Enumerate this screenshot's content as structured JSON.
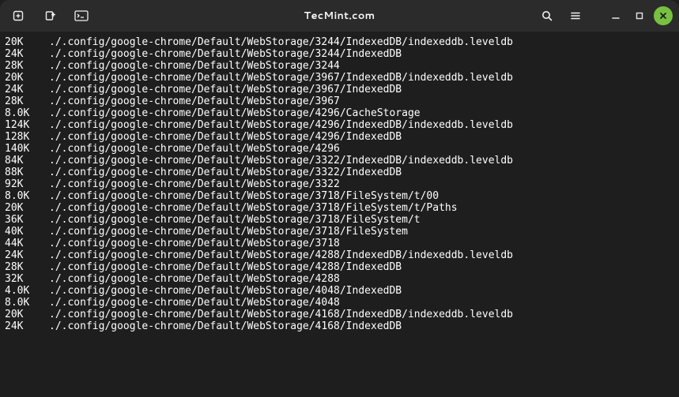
{
  "titlebar": {
    "title": "TecMint.com"
  },
  "lines": [
    {
      "size": "20K",
      "path": "./.config/google-chrome/Default/WebStorage/3244/IndexedDB/indexeddb.leveldb"
    },
    {
      "size": "24K",
      "path": "./.config/google-chrome/Default/WebStorage/3244/IndexedDB"
    },
    {
      "size": "28K",
      "path": "./.config/google-chrome/Default/WebStorage/3244"
    },
    {
      "size": "20K",
      "path": "./.config/google-chrome/Default/WebStorage/3967/IndexedDB/indexeddb.leveldb"
    },
    {
      "size": "24K",
      "path": "./.config/google-chrome/Default/WebStorage/3967/IndexedDB"
    },
    {
      "size": "28K",
      "path": "./.config/google-chrome/Default/WebStorage/3967"
    },
    {
      "size": "8.0K",
      "path": "./.config/google-chrome/Default/WebStorage/4296/CacheStorage"
    },
    {
      "size": "124K",
      "path": "./.config/google-chrome/Default/WebStorage/4296/IndexedDB/indexeddb.leveldb"
    },
    {
      "size": "128K",
      "path": "./.config/google-chrome/Default/WebStorage/4296/IndexedDB"
    },
    {
      "size": "140K",
      "path": "./.config/google-chrome/Default/WebStorage/4296"
    },
    {
      "size": "84K",
      "path": "./.config/google-chrome/Default/WebStorage/3322/IndexedDB/indexeddb.leveldb"
    },
    {
      "size": "88K",
      "path": "./.config/google-chrome/Default/WebStorage/3322/IndexedDB"
    },
    {
      "size": "92K",
      "path": "./.config/google-chrome/Default/WebStorage/3322"
    },
    {
      "size": "8.0K",
      "path": "./.config/google-chrome/Default/WebStorage/3718/FileSystem/t/00"
    },
    {
      "size": "20K",
      "path": "./.config/google-chrome/Default/WebStorage/3718/FileSystem/t/Paths"
    },
    {
      "size": "36K",
      "path": "./.config/google-chrome/Default/WebStorage/3718/FileSystem/t"
    },
    {
      "size": "40K",
      "path": "./.config/google-chrome/Default/WebStorage/3718/FileSystem"
    },
    {
      "size": "44K",
      "path": "./.config/google-chrome/Default/WebStorage/3718"
    },
    {
      "size": "24K",
      "path": "./.config/google-chrome/Default/WebStorage/4288/IndexedDB/indexeddb.leveldb"
    },
    {
      "size": "28K",
      "path": "./.config/google-chrome/Default/WebStorage/4288/IndexedDB"
    },
    {
      "size": "32K",
      "path": "./.config/google-chrome/Default/WebStorage/4288"
    },
    {
      "size": "4.0K",
      "path": "./.config/google-chrome/Default/WebStorage/4048/IndexedDB"
    },
    {
      "size": "8.0K",
      "path": "./.config/google-chrome/Default/WebStorage/4048"
    },
    {
      "size": "20K",
      "path": "./.config/google-chrome/Default/WebStorage/4168/IndexedDB/indexeddb.leveldb"
    },
    {
      "size": "24K",
      "path": "./.config/google-chrome/Default/WebStorage/4168/IndexedDB"
    }
  ]
}
